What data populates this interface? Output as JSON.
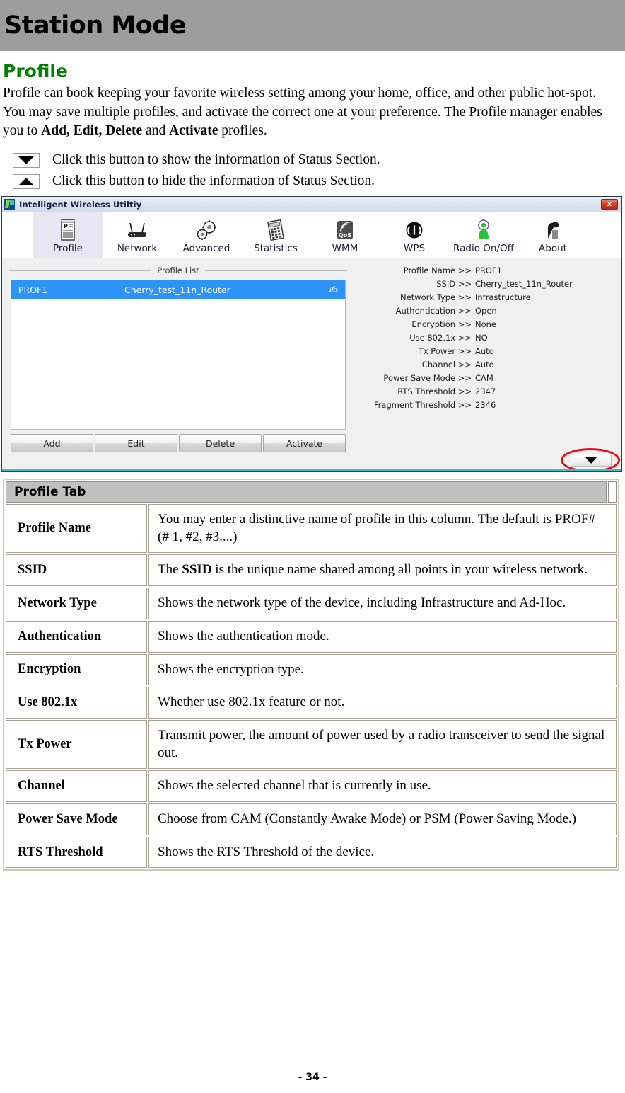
{
  "page": {
    "banner_title": "Station Mode",
    "section_title": "Profile",
    "intro_part1": "Profile can book keeping your favorite wireless setting among your home, office, and other public hot-spot. You may save multiple profiles, and activate the correct one at your preference. The Profile manager enables you to ",
    "intro_bold1": "Add, Edit, Delete",
    "intro_mid": " and ",
    "intro_bold2": "Activate",
    "intro_part2": " profiles.",
    "footer": "- 34 -"
  },
  "legend": {
    "show_icon": "triangle-down-icon",
    "show_text": "Click this button to show the information of Status Section.",
    "hide_icon": "triangle-up-icon",
    "hide_text": "Click this button to hide the information of Status Section."
  },
  "app": {
    "title": "Intelligent Wireless Utiltiy",
    "title_icon": "app-logo-icon",
    "close_label": "x",
    "tabs": [
      {
        "label": "Profile",
        "icon": "profile-document-icon",
        "active": true
      },
      {
        "label": "Network",
        "icon": "router-icon",
        "active": false
      },
      {
        "label": "Advanced",
        "icon": "gears-icon",
        "active": false
      },
      {
        "label": "Statistics",
        "icon": "calculator-icon",
        "active": false
      },
      {
        "label": "WMM",
        "icon": "qos-icon",
        "active": false
      },
      {
        "label": "WPS",
        "icon": "wps-arrows-icon",
        "active": false
      },
      {
        "label": "Radio On/Off",
        "icon": "radio-antenna-icon",
        "active": false
      },
      {
        "label": "About",
        "icon": "satellite-dish-icon",
        "active": false
      }
    ],
    "profile_list": {
      "group_label": "Profile List",
      "rows": [
        {
          "name": "PROF1",
          "ssid": "Cherry_test_11n_Router",
          "status_icon": "active-hand-icon",
          "selected": true
        }
      ]
    },
    "buttons": [
      {
        "label": "Add"
      },
      {
        "label": "Edit"
      },
      {
        "label": "Delete"
      },
      {
        "label": "Activate"
      }
    ],
    "details": [
      {
        "label": "Profile Name >>",
        "value": "PROF1"
      },
      {
        "label": "SSID >>",
        "value": "Cherry_test_11n_Router"
      },
      {
        "label": "Network Type >>",
        "value": "Infrastructure"
      },
      {
        "label": "Authentication >>",
        "value": "Open"
      },
      {
        "label": "Encryption >>",
        "value": "None"
      },
      {
        "label": "Use 802.1x >>",
        "value": "NO"
      },
      {
        "label": "Tx Power >>",
        "value": "Auto"
      },
      {
        "label": "Channel >>",
        "value": "Auto"
      },
      {
        "label": "Power Save Mode >>",
        "value": "CAM"
      },
      {
        "label": "RTS Threshold >>",
        "value": "2347"
      },
      {
        "label": "Fragment Threshold >>",
        "value": "2346"
      }
    ],
    "status_toggle_icon": "triangle-down-icon",
    "annotation_shape": "red-ellipse-highlight"
  },
  "ref_table": {
    "header": "Profile Tab",
    "rows": [
      {
        "key": "Profile Name",
        "desc": "You may enter a distinctive name of profile in this column. The default is PROF# (# 1, #2, #3....)"
      },
      {
        "key": "SSID",
        "desc_pre": "The ",
        "desc_bold": "SSID",
        "desc_post": " is the unique name shared among all points in your wireless network."
      },
      {
        "key": "Network Type",
        "desc": "Shows the network type of the device, including Infrastructure and Ad-Hoc."
      },
      {
        "key": "Authentication",
        "desc": "Shows the authentication mode."
      },
      {
        "key": "Encryption",
        "desc": "Shows the encryption type."
      },
      {
        "key": "Use 802.1x",
        "desc": "Whether use 802.1x feature or not."
      },
      {
        "key": "Tx Power",
        "desc": "Transmit power, the amount of power used by a radio transceiver to send the signal out."
      },
      {
        "key": "Channel",
        "desc": "Shows the selected channel that is currently in use."
      },
      {
        "key": "Power Save Mode",
        "desc": "Choose from CAM (Constantly Awake Mode) or PSM (Power Saving Mode.)"
      },
      {
        "key": "RTS Threshold",
        "desc": "Shows the RTS Threshold of the device."
      }
    ]
  },
  "colors": {
    "banner_gray": "#9d9d9d",
    "heading_green": "#008000",
    "selection_blue": "#2e93f7",
    "annotation_red": "#e11010",
    "table_header_gray": "#c0c0c0",
    "window_accent_cyan": "#3db9d6"
  }
}
